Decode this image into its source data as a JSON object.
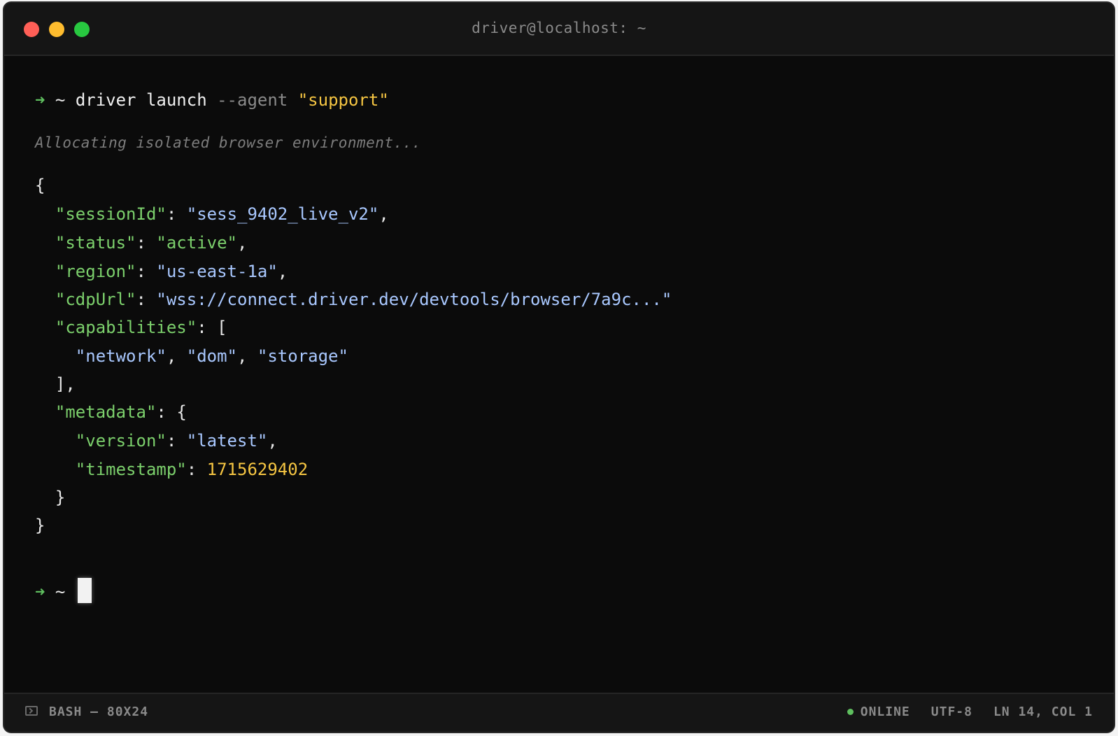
{
  "window": {
    "title": "driver@localhost: ~",
    "colors": {
      "red": "#ff5f57",
      "yellow": "#febc2e",
      "green": "#28c840"
    }
  },
  "terminal": {
    "prompt_arrow": "➜",
    "prompt_dir": "~",
    "command": "driver launch",
    "flag": "--agent",
    "flag_value": "\"support\"",
    "info_message": "Allocating isolated browser environment...",
    "json_output": {
      "open_brace": "{",
      "session_key": "\"sessionId\"",
      "session_val": "\"sess_9402_live_v2\"",
      "status_key": "\"status\"",
      "status_val": "\"active\"",
      "region_key": "\"region\"",
      "region_val": "\"us-east-1a\"",
      "cdp_key": "\"cdpUrl\"",
      "cdp_val": "\"wss://connect.driver.dev/devtools/browser/7a9c...\"",
      "cap_key": "\"capabilities\"",
      "cap_open": "[",
      "cap_1": "\"network\"",
      "cap_2": "\"dom\"",
      "cap_3": "\"storage\"",
      "cap_close": "],",
      "meta_key": "\"metadata\"",
      "meta_open": "{",
      "version_key": "\"version\"",
      "version_val": "\"latest\"",
      "timestamp_key": "\"timestamp\"",
      "timestamp_val": "1715629402",
      "meta_close": "}",
      "close_brace": "}"
    }
  },
  "statusbar": {
    "shell": "BASH — 80X24",
    "connection": "ONLINE",
    "encoding": "UTF-8",
    "position": "LN 14, COL 1"
  }
}
